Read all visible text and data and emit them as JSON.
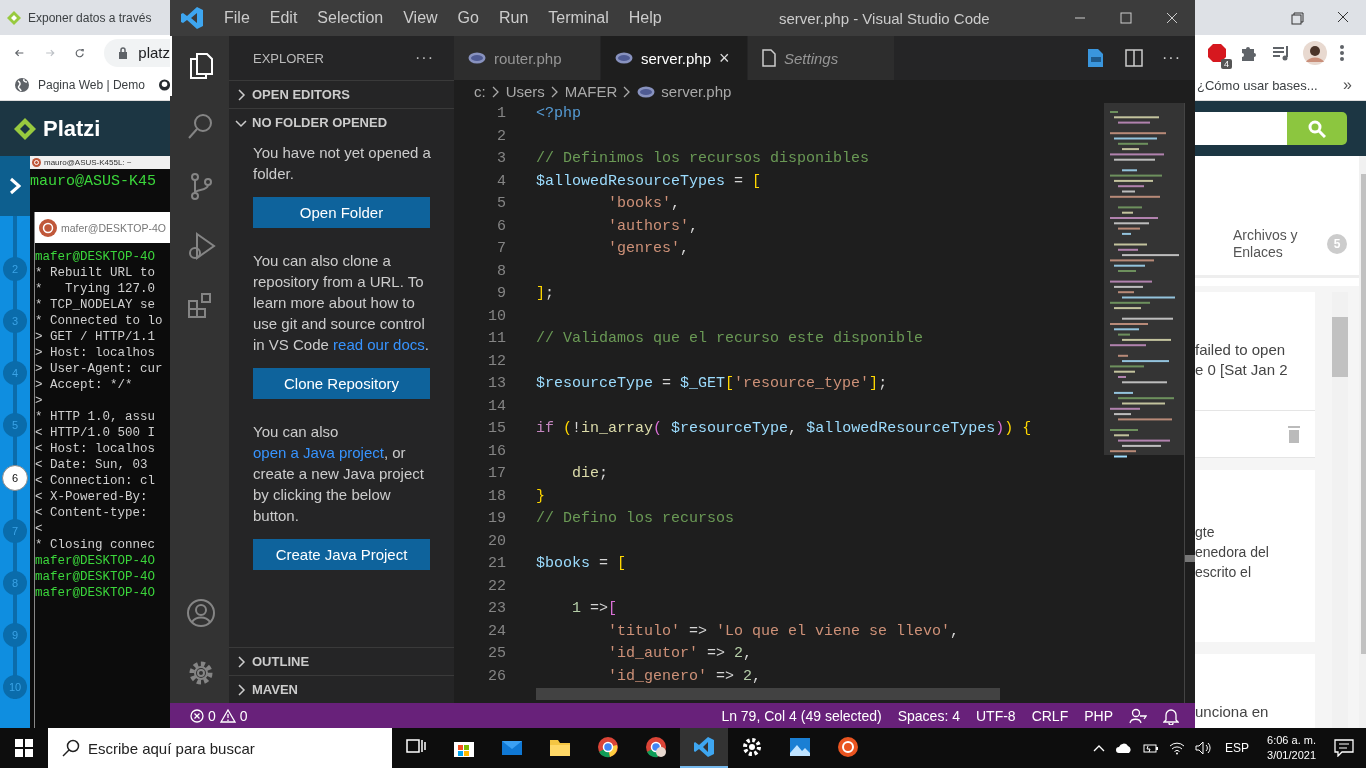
{
  "browser": {
    "tab_title": "Exponer datos a través",
    "address": "platz",
    "bookmarks": [
      {
        "label": "Pagina Web | Demo"
      }
    ],
    "site_logo": "Platzi",
    "steps": [
      {
        "label": "2",
        "selected": false
      },
      {
        "label": "3",
        "selected": false
      },
      {
        "label": "4",
        "selected": false
      },
      {
        "label": "5",
        "selected": false
      },
      {
        "label": "6",
        "selected": true
      },
      {
        "label": "7",
        "selected": false
      },
      {
        "label": "8",
        "selected": false
      },
      {
        "label": "9",
        "selected": false
      },
      {
        "label": "10",
        "selected": false
      }
    ],
    "extension_badge": "4",
    "bookmark_right": "¿Cómo usar bases...",
    "bookmark_more": "»",
    "files_tab": {
      "label": "Archivos y Enlaces",
      "count": "5"
    },
    "cards": [
      {
        "lines": [
          "failed to open",
          "e 0 [Sat Jan 2"
        ]
      },
      {
        "lines": [
          "gte",
          "enedora del",
          "escrito el"
        ]
      },
      {
        "lines": [
          "unciona en"
        ]
      }
    ]
  },
  "terminals": [
    {
      "title": "mauro@ASUS-K455L: ~",
      "lines": [
        {
          "kind": "prompt",
          "text": "mauro@ASUS-K45"
        }
      ]
    },
    {
      "title": "mafer@DESKTOP-4O",
      "lines": [
        {
          "kind": "prompt",
          "text": "mafer@DESKTOP-4O"
        },
        {
          "kind": "output",
          "text": "* Rebuilt URL to"
        },
        {
          "kind": "output",
          "text": "*   Trying 127.0"
        },
        {
          "kind": "output",
          "text": "* TCP_NODELAY se"
        },
        {
          "kind": "output",
          "text": "* Connected to lo"
        },
        {
          "kind": "output",
          "text": "> GET / HTTP/1.1"
        },
        {
          "kind": "output",
          "text": "> Host: localhos"
        },
        {
          "kind": "output",
          "text": "> User-Agent: cur"
        },
        {
          "kind": "output",
          "text": "> Accept: */*"
        },
        {
          "kind": "output",
          "text": ">"
        },
        {
          "kind": "output",
          "text": "* HTTP 1.0, assu"
        },
        {
          "kind": "output",
          "text": "< HTTP/1.0 500 I"
        },
        {
          "kind": "output",
          "text": "< Host: localhos"
        },
        {
          "kind": "output",
          "text": "< Date: Sun, 03"
        },
        {
          "kind": "output",
          "text": "< Connection: cl"
        },
        {
          "kind": "output",
          "text": "< X-Powered-By:"
        },
        {
          "kind": "output",
          "text": "< Content-type:"
        },
        {
          "kind": "output",
          "text": "<"
        },
        {
          "kind": "output",
          "text": "* Closing connec"
        },
        {
          "kind": "prompt",
          "text": "mafer@DESKTOP-4O"
        },
        {
          "kind": "prompt",
          "text": "mafer@DESKTOP-4O"
        },
        {
          "kind": "prompt",
          "text": "mafer@DESKTOP-4O"
        }
      ]
    }
  ],
  "vscode": {
    "menu": [
      "File",
      "Edit",
      "Selection",
      "View",
      "Go",
      "Run",
      "Terminal",
      "Help"
    ],
    "title": "server.php - Visual Studio Code",
    "activity": [
      {
        "kind": "explorer",
        "selected": true
      },
      {
        "kind": "search",
        "selected": false
      },
      {
        "kind": "source-control",
        "selected": false
      },
      {
        "kind": "run",
        "selected": false
      },
      {
        "kind": "extensions",
        "selected": false
      }
    ],
    "explorer": {
      "title": "EXPLORER",
      "more": "···",
      "sections": [
        {
          "title": "OPEN EDITORS",
          "expanded": false
        },
        {
          "title": "NO FOLDER OPENED",
          "expanded": true,
          "content": [
            {
              "kind": "text",
              "text": "You have not yet opened a folder."
            },
            {
              "kind": "button",
              "label": "Open Folder"
            },
            {
              "kind": "text",
              "text": "You can also clone a repository from a URL. To learn more about how to use git and source control in VS Code ",
              "link": "read our docs",
              "after": "."
            },
            {
              "kind": "button",
              "label": "Clone Repository"
            },
            {
              "kind": "text",
              "text": "You can also ",
              "link": "open a Java project",
              "after": ", or create a new Java project by clicking the below button."
            },
            {
              "kind": "button",
              "label": "Create Java Project"
            }
          ]
        }
      ],
      "bottom_sections": [
        {
          "title": "OUTLINE",
          "expanded": false
        },
        {
          "title": "MAVEN",
          "expanded": false
        }
      ]
    },
    "tabs": [
      {
        "label": "router.php",
        "kind": "php",
        "selected": false
      },
      {
        "label": "server.php",
        "kind": "php",
        "selected": true,
        "close": "×"
      },
      {
        "label": "Settings",
        "kind": "settings",
        "selected": false
      }
    ],
    "tab_more": "···",
    "breadcrumb": [
      {
        "label": "c:",
        "kind": "folder"
      },
      {
        "label": "Users",
        "kind": "folder"
      },
      {
        "label": "MAFER",
        "kind": "folder"
      },
      {
        "label": "server.php",
        "kind": "php"
      }
    ],
    "code": [
      {
        "number": "1",
        "tokens": [
          {
            "kind": "tag",
            "text": "<?php"
          }
        ]
      },
      {
        "number": "2"
      },
      {
        "number": "3",
        "tokens": [
          {
            "kind": "comment",
            "text": "// Definimos los recursos disponibles"
          }
        ]
      },
      {
        "number": "4",
        "tokens": [
          {
            "kind": "variable",
            "text": "$allowedResourceTypes"
          },
          {
            "kind": "plain",
            "text": " = "
          },
          {
            "kind": "bracket1",
            "text": "["
          }
        ]
      },
      {
        "number": "5",
        "tokens": [
          {
            "kind": "string",
            "text": "        'books'"
          },
          {
            "kind": "plain",
            "text": ","
          }
        ]
      },
      {
        "number": "6",
        "tokens": [
          {
            "kind": "string",
            "text": "        'authors'"
          },
          {
            "kind": "plain",
            "text": ","
          }
        ]
      },
      {
        "number": "7",
        "tokens": [
          {
            "kind": "string",
            "text": "        'genres'"
          },
          {
            "kind": "plain",
            "text": ","
          }
        ]
      },
      {
        "number": "8"
      },
      {
        "number": "9",
        "tokens": [
          {
            "kind": "bracket1",
            "text": "]"
          },
          {
            "kind": "plain",
            "text": ";"
          }
        ]
      },
      {
        "number": "10"
      },
      {
        "number": "11",
        "tokens": [
          {
            "kind": "comment",
            "text": "// Validamos que el recurso este disponible"
          }
        ]
      },
      {
        "number": "12"
      },
      {
        "number": "13",
        "tokens": [
          {
            "kind": "variable",
            "text": "$resourceType"
          },
          {
            "kind": "plain",
            "text": " = "
          },
          {
            "kind": "variable",
            "text": "$_GET"
          },
          {
            "kind": "bracket1",
            "text": "["
          },
          {
            "kind": "string",
            "text": "'resource_type'"
          },
          {
            "kind": "bracket1",
            "text": "]"
          },
          {
            "kind": "plain",
            "text": ";"
          }
        ]
      },
      {
        "number": "14"
      },
      {
        "number": "15",
        "tokens": [
          {
            "kind": "keyword",
            "text": "if"
          },
          {
            "kind": "bracket1",
            "text": " ("
          },
          {
            "kind": "plain",
            "text": "!"
          },
          {
            "kind": "function",
            "text": "in_array"
          },
          {
            "kind": "bracket2",
            "text": "("
          },
          {
            "kind": "variable",
            "text": " $resourceType"
          },
          {
            "kind": "plain",
            "text": ", "
          },
          {
            "kind": "variable",
            "text": "$allowedResourceTypes"
          },
          {
            "kind": "bracket2",
            "text": ")"
          },
          {
            "kind": "bracket1",
            "text": ")"
          },
          {
            "kind": "bracket1",
            "text": " {"
          }
        ]
      },
      {
        "number": "16"
      },
      {
        "number": "17",
        "tokens": [
          {
            "kind": "function",
            "text": "    die"
          },
          {
            "kind": "plain",
            "text": ";"
          }
        ]
      },
      {
        "number": "18",
        "tokens": [
          {
            "kind": "bracket1",
            "text": "}"
          }
        ]
      },
      {
        "number": "19",
        "tokens": [
          {
            "kind": "comment",
            "text": "// Defino los recursos"
          }
        ]
      },
      {
        "number": "20"
      },
      {
        "number": "21",
        "tokens": [
          {
            "kind": "variable",
            "text": "$books"
          },
          {
            "kind": "plain",
            "text": " = "
          },
          {
            "kind": "bracket1",
            "text": "["
          }
        ]
      },
      {
        "number": "22"
      },
      {
        "number": "23",
        "tokens": [
          {
            "kind": "number",
            "text": "    1"
          },
          {
            "kind": "plain",
            "text": " =>"
          },
          {
            "kind": "bracket2",
            "text": "["
          }
        ]
      },
      {
        "number": "24",
        "tokens": [
          {
            "kind": "string",
            "text": "        'titulo'"
          },
          {
            "kind": "plain",
            "text": " => "
          },
          {
            "kind": "string",
            "text": "'Lo que el viene se llevo'"
          },
          {
            "kind": "plain",
            "text": ","
          }
        ]
      },
      {
        "number": "25",
        "tokens": [
          {
            "kind": "string",
            "text": "        'id_autor'"
          },
          {
            "kind": "plain",
            "text": " => "
          },
          {
            "kind": "number",
            "text": "2"
          },
          {
            "kind": "plain",
            "text": ","
          }
        ]
      },
      {
        "number": "26",
        "tokens": [
          {
            "kind": "string",
            "text": "        'id_genero'"
          },
          {
            "kind": "plain",
            "text": " => "
          },
          {
            "kind": "number",
            "text": "2"
          },
          {
            "kind": "plain",
            "text": ","
          }
        ]
      }
    ],
    "status_bar": {
      "errors": "0",
      "warnings": "0",
      "items": [
        "Ln 79, Col 4 (49 selected)",
        "Spaces: 4",
        "UTF-8",
        "CRLF",
        "PHP"
      ]
    }
  },
  "taskbar": {
    "search_placeholder": "Escribe aquí para buscar",
    "apps": [
      {
        "kind": "task-view",
        "selected": false
      },
      {
        "kind": "store",
        "selected": false
      },
      {
        "kind": "mail",
        "selected": false
      },
      {
        "kind": "folder",
        "selected": false
      },
      {
        "kind": "browser",
        "selected": false
      },
      {
        "kind": "browser-profile",
        "selected": false
      },
      {
        "kind": "editor",
        "selected": true
      },
      {
        "kind": "settings",
        "selected": false
      },
      {
        "kind": "photos",
        "selected": false
      },
      {
        "kind": "ubuntu",
        "selected": false
      }
    ],
    "language": "ESP",
    "time": "6:06 a. m.",
    "date": "3/01/2021"
  }
}
